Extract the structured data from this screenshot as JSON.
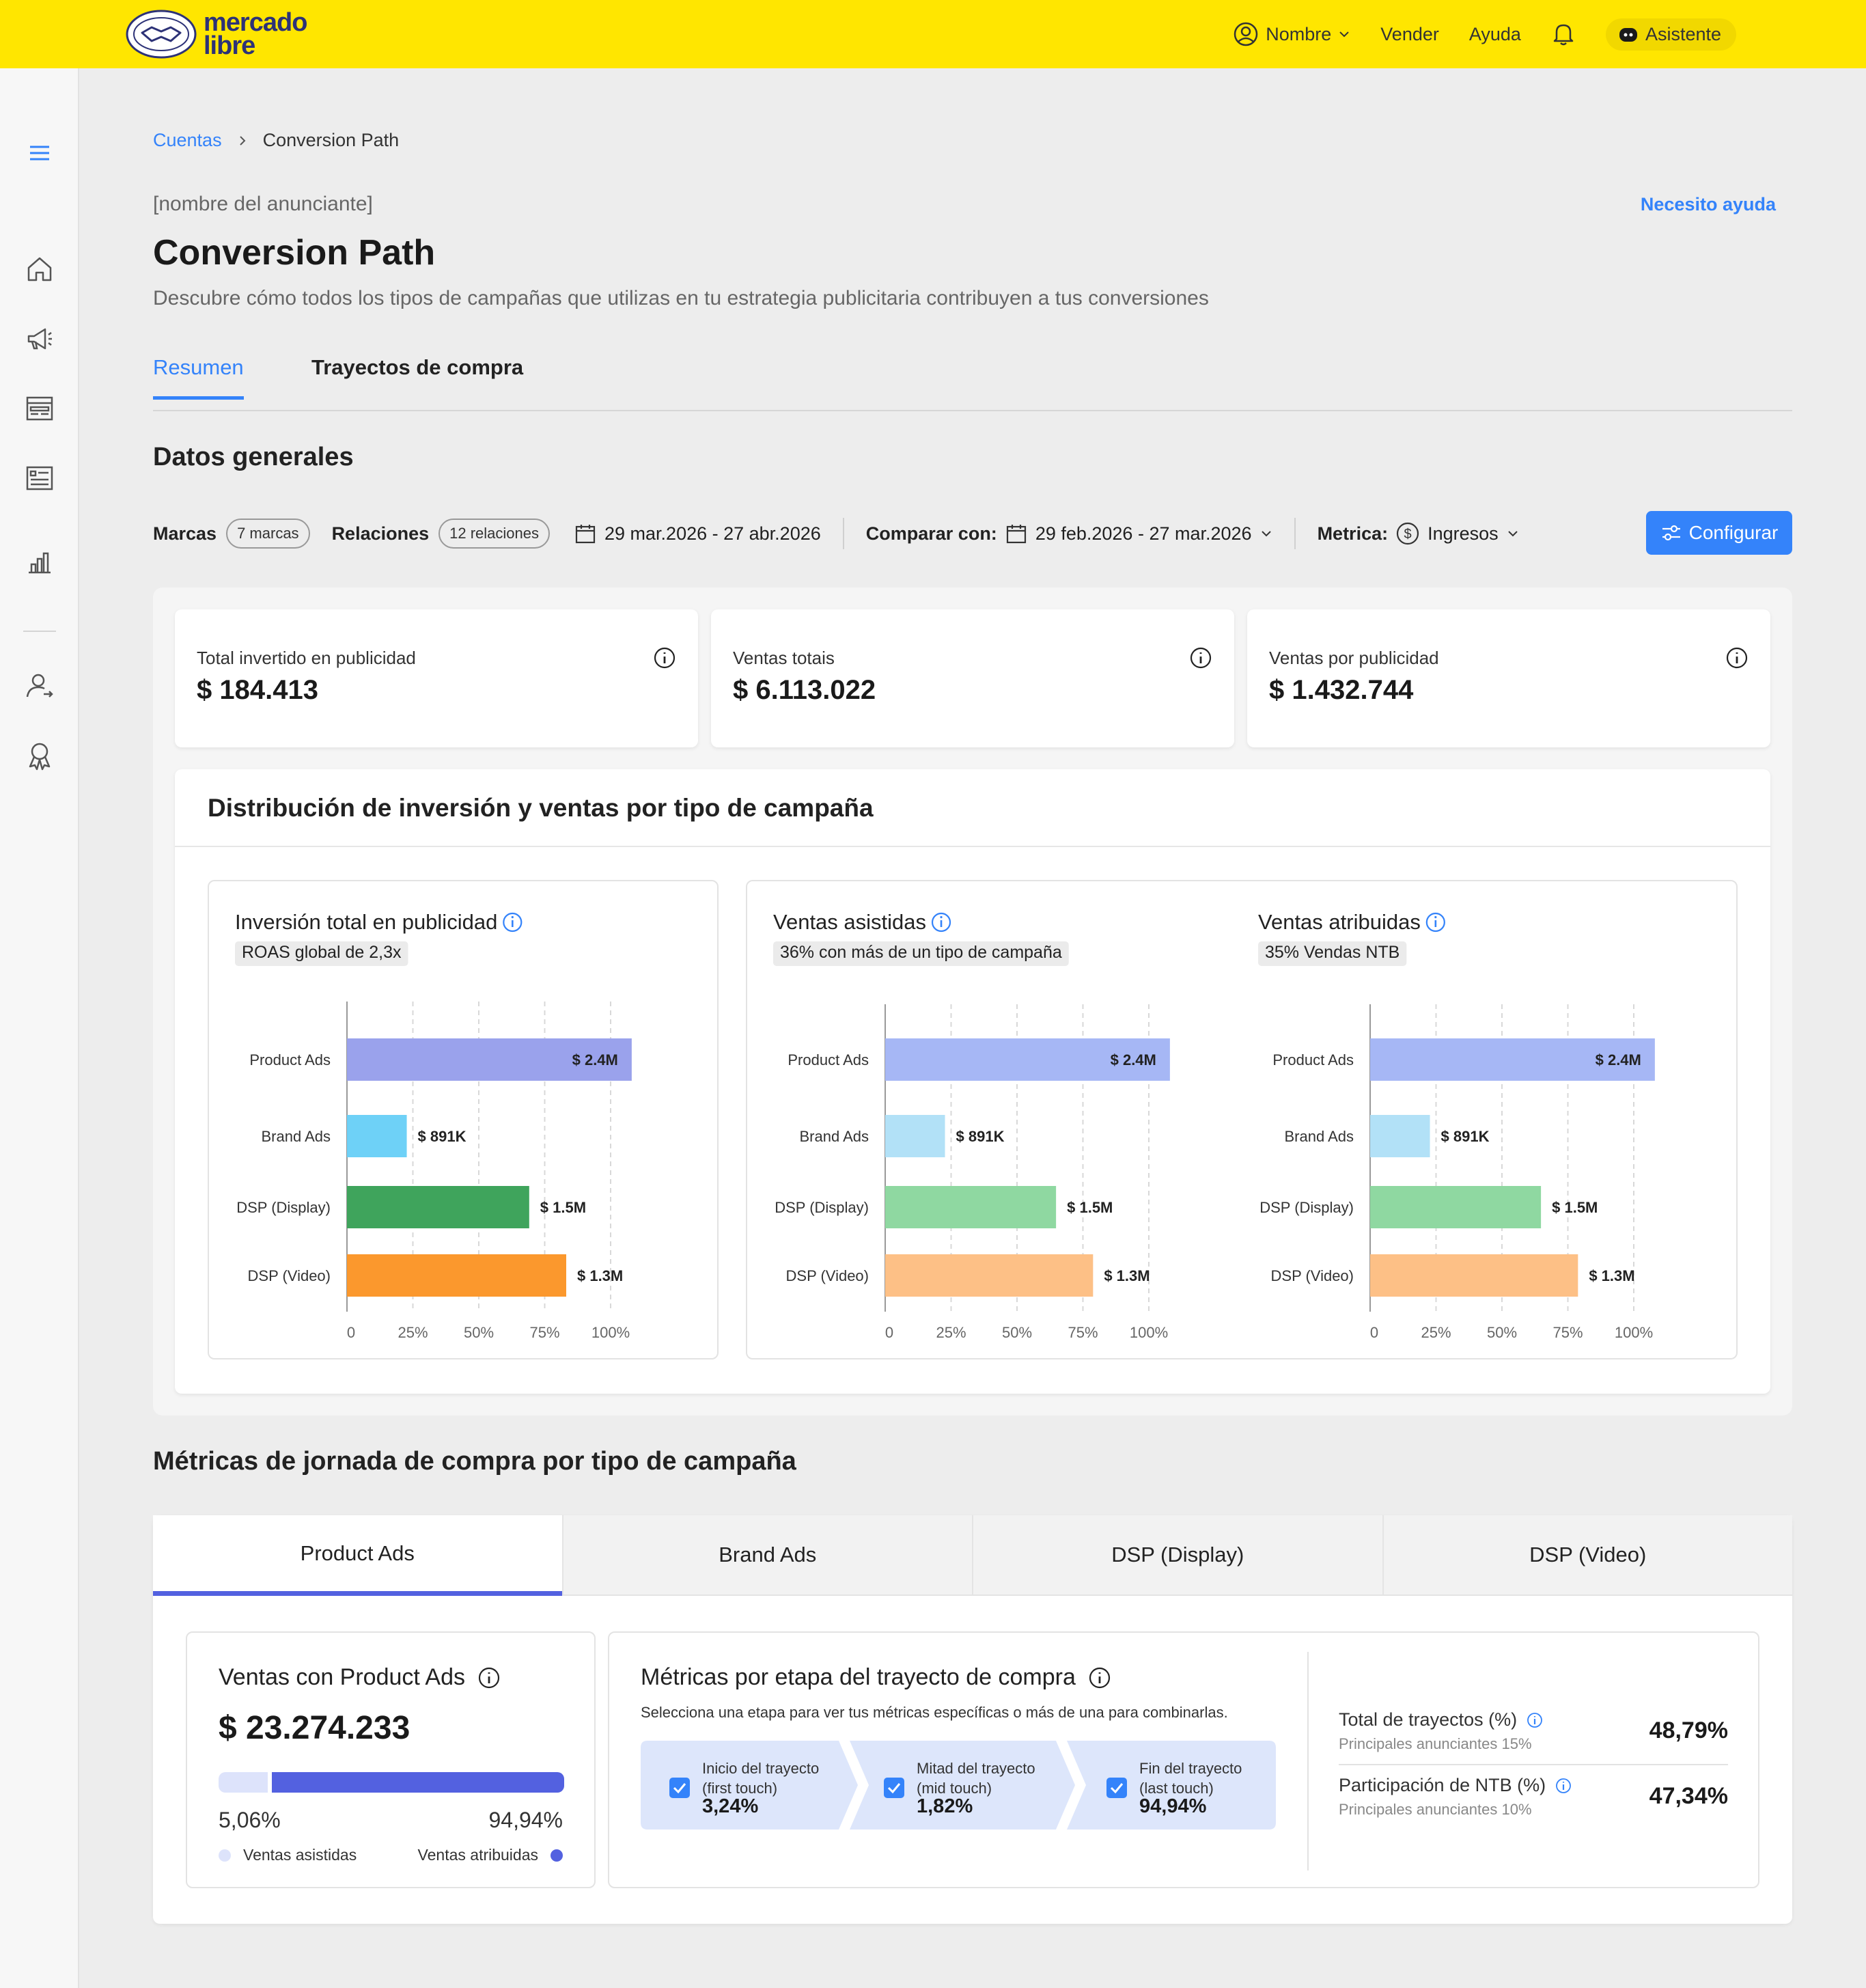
{
  "header": {
    "logo_line1": "mercado",
    "logo_line2": "libre",
    "user": "Nombre",
    "sell": "Vender",
    "help": "Ayuda",
    "assistant": "Asistente"
  },
  "sidebar": {
    "icons": [
      "menu-icon",
      "home-icon",
      "megaphone-icon",
      "display-ads-icon",
      "list-ads-icon",
      "bar-chart-icon",
      "user-switch-icon",
      "award-icon"
    ]
  },
  "breadcrumb": {
    "parent": "Cuentas",
    "current": "Conversion Path"
  },
  "advertiser": "[nombre del anunciante]",
  "help_link": "Necesito ayuda",
  "page": {
    "title": "Conversion Path",
    "subtitle": "Descubre cómo todos los tipos de campañas que utilizas en tu estrategia publicitaria contribuyen a tus conversiones"
  },
  "tabs": {
    "summary": "Resumen",
    "journeys": "Trayectos de compra"
  },
  "general": {
    "title": "Datos generales"
  },
  "filters": {
    "brands_label": "Marcas",
    "brands_value": "7 marcas",
    "relations_label": "Relaciones",
    "relations_value": "12 relaciones",
    "date_range": "29 mar.2026 - 27 abr.2026",
    "compare_label": "Comparar con:",
    "compare_range": "29 feb.2026 - 27 mar.2026",
    "metric_label": "Metrica:",
    "metric_value": "Ingresos",
    "configure": "Configurar"
  },
  "kpis": [
    {
      "label": "Total invertido en publicidad",
      "value": "$ 184.413"
    },
    {
      "label": "Ventas totais",
      "value": "$ 6.113.022"
    },
    {
      "label": "Ventas por publicidad",
      "value": "$ 1.432.744"
    }
  ],
  "distribution": {
    "title": "Distribución de inversión y ventas por tipo de campaña"
  },
  "chart_data": [
    {
      "type": "bar",
      "orientation": "horizontal",
      "title": "Inversión total en publicidad",
      "subtitle": "ROAS global de 2,3x",
      "categories": [
        "Product Ads",
        "Brand Ads",
        "DSP (Display)",
        "DSP (Video)"
      ],
      "values": [
        2.4,
        0.891,
        1.5,
        1.3
      ],
      "value_units": "M",
      "value_fraction": [
        1.0,
        0.21,
        0.64,
        0.77
      ],
      "value_labels": [
        "$ 2.4M",
        "$ 891K",
        "$ 1.5M",
        "$ 1.3M"
      ],
      "x_ticks": [
        "0",
        "25%",
        "50%",
        "75%",
        "100%"
      ],
      "xlim": [
        0,
        1
      ],
      "grid": true,
      "colors": [
        "#9aa2ec",
        "#6ed1f7",
        "#3fa45c",
        "#fb982d"
      ]
    },
    {
      "type": "bar",
      "orientation": "horizontal",
      "title": "Ventas asistidas",
      "subtitle": "36% con más de un tipo de campaña",
      "categories": [
        "Product Ads",
        "Brand Ads",
        "DSP (Display)",
        "DSP (Video)"
      ],
      "values": [
        2.4,
        0.891,
        1.5,
        1.3
      ],
      "value_units": "M",
      "value_fraction": [
        1.0,
        0.21,
        0.6,
        0.73
      ],
      "value_labels": [
        "$ 2.4M",
        "$ 891K",
        "$ 1.5M",
        "$ 1.3M"
      ],
      "x_ticks": [
        "0",
        "25%",
        "50%",
        "75%",
        "100%"
      ],
      "xlim": [
        0,
        1
      ],
      "grid": true,
      "colors": [
        "#a6b7f5",
        "#b2e1f7",
        "#8fd8a1",
        "#fdc086"
      ]
    },
    {
      "type": "bar",
      "orientation": "horizontal",
      "title": "Ventas atribuidas",
      "subtitle": "35% Vendas NTB",
      "categories": [
        "Product Ads",
        "Brand Ads",
        "DSP (Display)",
        "DSP (Video)"
      ],
      "values": [
        2.4,
        0.891,
        1.5,
        1.3
      ],
      "value_units": "M",
      "value_fraction": [
        1.0,
        0.21,
        0.6,
        0.73
      ],
      "value_labels": [
        "$ 2.4M",
        "$ 891K",
        "$ 1.5M",
        "$ 1.3M"
      ],
      "x_ticks": [
        "0",
        "25%",
        "50%",
        "75%",
        "100%"
      ],
      "xlim": [
        0,
        1
      ],
      "grid": true,
      "colors": [
        "#a6b7f5",
        "#b2e1f7",
        "#8fd8a1",
        "#fdc086"
      ]
    }
  ],
  "metrics": {
    "title": "Métricas de jornada de compra por tipo de campaña",
    "tabs": [
      "Product Ads",
      "Brand Ads",
      "DSP (Display)",
      "DSP (Video)"
    ],
    "active_tab": "Product Ads",
    "sales_card": {
      "title": "Ventas con Product Ads",
      "value": "$ 23.274.233",
      "assisted_pct": "5,06%",
      "attributed_pct": "94,94%",
      "assisted_label": "Ventas asistidas",
      "attributed_label": "Ventas atribuidas",
      "assisted_fraction": 0.0506,
      "attributed_fraction": 0.9494,
      "assisted_color": "#dde3fb",
      "attributed_color": "#5361e0"
    },
    "stages_card": {
      "title": "Métricas por etapa del trayecto de compra",
      "subtitle": "Selecciona una etapa para ver tus métricas específicas o más de una para combinarlas.",
      "stages": [
        {
          "line1": "Inicio del trayecto",
          "line2": "(first touch)",
          "pct": "3,24%",
          "checked": true
        },
        {
          "line1": "Mitad del trayecto",
          "line2": "(mid touch)",
          "pct": "1,82%",
          "checked": true
        },
        {
          "line1": "Fin del trayecto",
          "line2": "(last touch)",
          "pct": "94,94%",
          "checked": true
        }
      ],
      "totals": [
        {
          "label": "Total de trayectos (%)",
          "sub": "Principales anunciantes 15%",
          "value": "48,79%"
        },
        {
          "label": "Participación de NTB (%)",
          "sub": "Principales anunciantes 10%",
          "value": "47,34%"
        }
      ]
    }
  },
  "colors": {
    "brand_yellow": "#ffe600",
    "accent_blue": "#3483fa",
    "tab_indigo": "#5361e0"
  }
}
